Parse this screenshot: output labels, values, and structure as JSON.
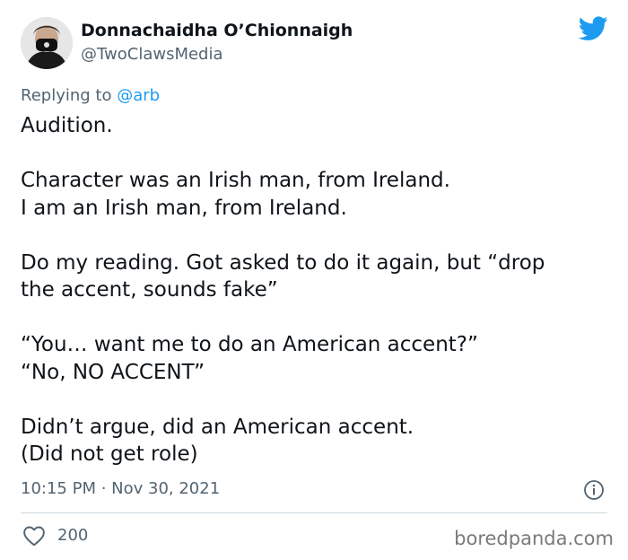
{
  "author": {
    "display_name": "Donnachaidha O’Chionnaigh",
    "handle": "@TwoClawsMedia",
    "avatar_icon": "profile-avatar"
  },
  "reply": {
    "prefix": "Replying to ",
    "mention": "@arb"
  },
  "tweet": {
    "paragraphs": [
      [
        "Audition."
      ],
      [
        "Character was an Irish man, from Ireland.",
        "I am an Irish man, from Ireland."
      ],
      [
        "Do my reading. Got asked to do it again, but “drop",
        "the accent, sounds fake”"
      ],
      [
        "“You… want me to do an American accent?”",
        "“No, NO ACCENT”"
      ],
      [
        "Didn’t argue, did an American accent.",
        "(Did not get role)"
      ]
    ]
  },
  "meta": {
    "timestamp": "10:15 PM · Nov 30, 2021"
  },
  "engagement": {
    "likes": "200"
  },
  "watermark": "boredpanda.com",
  "colors": {
    "twitter_blue": "#1d9bf0",
    "secondary_text": "#536471",
    "primary_text": "#0f1419",
    "divider": "#cfd9de"
  },
  "icons": {
    "logo": "twitter-bird-icon",
    "info": "info-icon",
    "like": "heart-icon"
  }
}
